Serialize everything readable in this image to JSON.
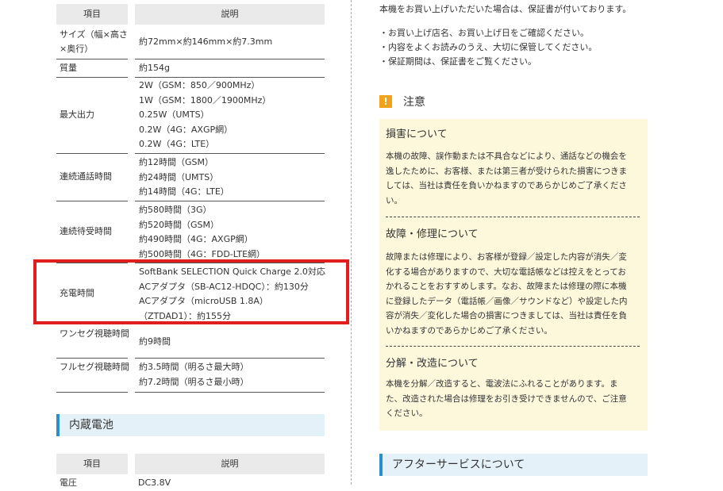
{
  "left": {
    "header": {
      "col1": "項目",
      "col2": "説明"
    },
    "rows": [
      {
        "label": "サイズ（幅×高さ×奥行）",
        "value": "約72mm×約146mm×約7.3mm"
      },
      {
        "label": "質量",
        "value": "約154g"
      },
      {
        "label": "最大出力",
        "lines": [
          "2W（GSM：850／900MHz）",
          "1W（GSM：1800／1900MHz）",
          "0.25W（UMTS）",
          "0.2W（4G：AXGP網）",
          "0.2W（4G：LTE）"
        ]
      },
      {
        "label": "連続通話時間",
        "lines": [
          "約12時間（GSM）",
          "約24時間（UMTS）",
          "約14時間（4G：LTE）"
        ]
      },
      {
        "label": "連続待受時間",
        "lines": [
          "約580時間（3G）",
          "約520時間（GSM）",
          "約490時間（4G：AXGP網）",
          "約500時間（4G：FDD-LTE網）"
        ]
      },
      {
        "label": "充電時間",
        "lines": [
          "SoftBank SELECTION Quick Charge 2.0対応",
          "ACアダプタ（SB-AC12-HDQC）：約130分",
          "ACアダプタ（microUSB 1.8A）",
          "（ZTDAD1）：約155分"
        ]
      },
      {
        "label": "ワンセグ視聴時間",
        "value": "約9時間"
      },
      {
        "label": "フルセグ視聴時間",
        "lines": [
          "約3.5時間（明るさ最大時）",
          "約7.2時間（明るさ最小時）"
        ]
      }
    ],
    "battery_heading": "内蔵電池",
    "header2": {
      "col1": "項目",
      "col2": "説明"
    },
    "partial_row": {
      "label": "電圧",
      "value": "DC3.8V"
    }
  },
  "right": {
    "warranty_text": "本機をお買い上げいただいた場合は、保証書が付いております。",
    "bullets": [
      "・お買い上げ店名、お買い上げ日をご確認ください。",
      "・内容をよくお読みのうえ、大切に保管してください。",
      "・保証期間は、保証書をご覧ください。"
    ],
    "caution_icon": "!",
    "caution_title": "注意",
    "damage_title": "損害について",
    "damage_lines": [
      "本機の故障、誤作動または不具合などにより、通話などの機会を",
      "逸したために、お客様、または第三者が受けられた損害につきま",
      "しては、当社は責任を負いかねますのであらかじめご了承くださ",
      "い。"
    ],
    "repair_title": "故障・修理について",
    "repair_lines": [
      "故障または修理により、お客様が登録／設定した内容が消失／変",
      "化する場合がありますので、大切な電話帳などは控えをとってお",
      "かれることをおすすめします。なお、故障または修理の際に本機",
      "に登録したデータ（電話帳／画像／サウンドなど）や設定した内",
      "容が消失／変化した場合の損害につきましては、当社は責任を負",
      "いかねますのであらかじめご了承ください。"
    ],
    "modify_title": "分解・改造について",
    "modify_lines": [
      "本機を分解／改造すると、電波法にふれることがあります。ま",
      "た、改造された場合は修理をお引き受けできませんので、ご注意",
      "ください。"
    ],
    "after_service_heading": "アフターサービスについて"
  },
  "colors": {
    "highlight": "#e01e1e",
    "section_accent": "#2b8fc9",
    "section_bg": "#e4f1f9",
    "note_bg": "#fdf8dc",
    "caution_icon": "#f0a21a"
  }
}
